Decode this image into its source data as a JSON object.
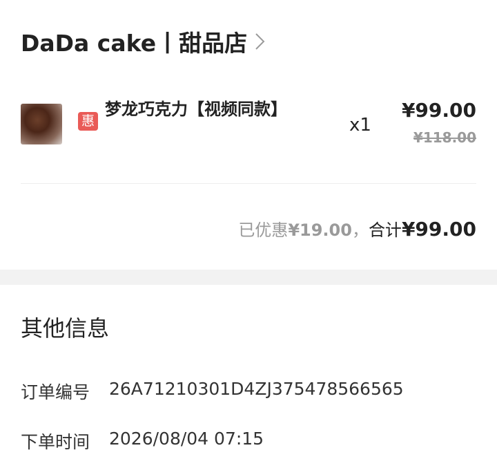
{
  "store": {
    "name": "DaDa cake丨甜品店"
  },
  "item": {
    "discount_badge": "惠",
    "name": "梦龙巧克力【视频同款】",
    "quantity": "x1",
    "price": "¥99.00",
    "original_price": "¥118.00"
  },
  "summary": {
    "discount_label": "已优惠",
    "discount_value": "¥19.00",
    "separator": "，",
    "total_label": "合计",
    "total_value": "¥99.00"
  },
  "other_info": {
    "title": "其他信息",
    "order_no_label": "订单编号",
    "order_no_value": "26A71210301D4ZJ375478566565",
    "order_time_label": "下单时间",
    "order_time_value": "2026/08/04 07:15"
  }
}
